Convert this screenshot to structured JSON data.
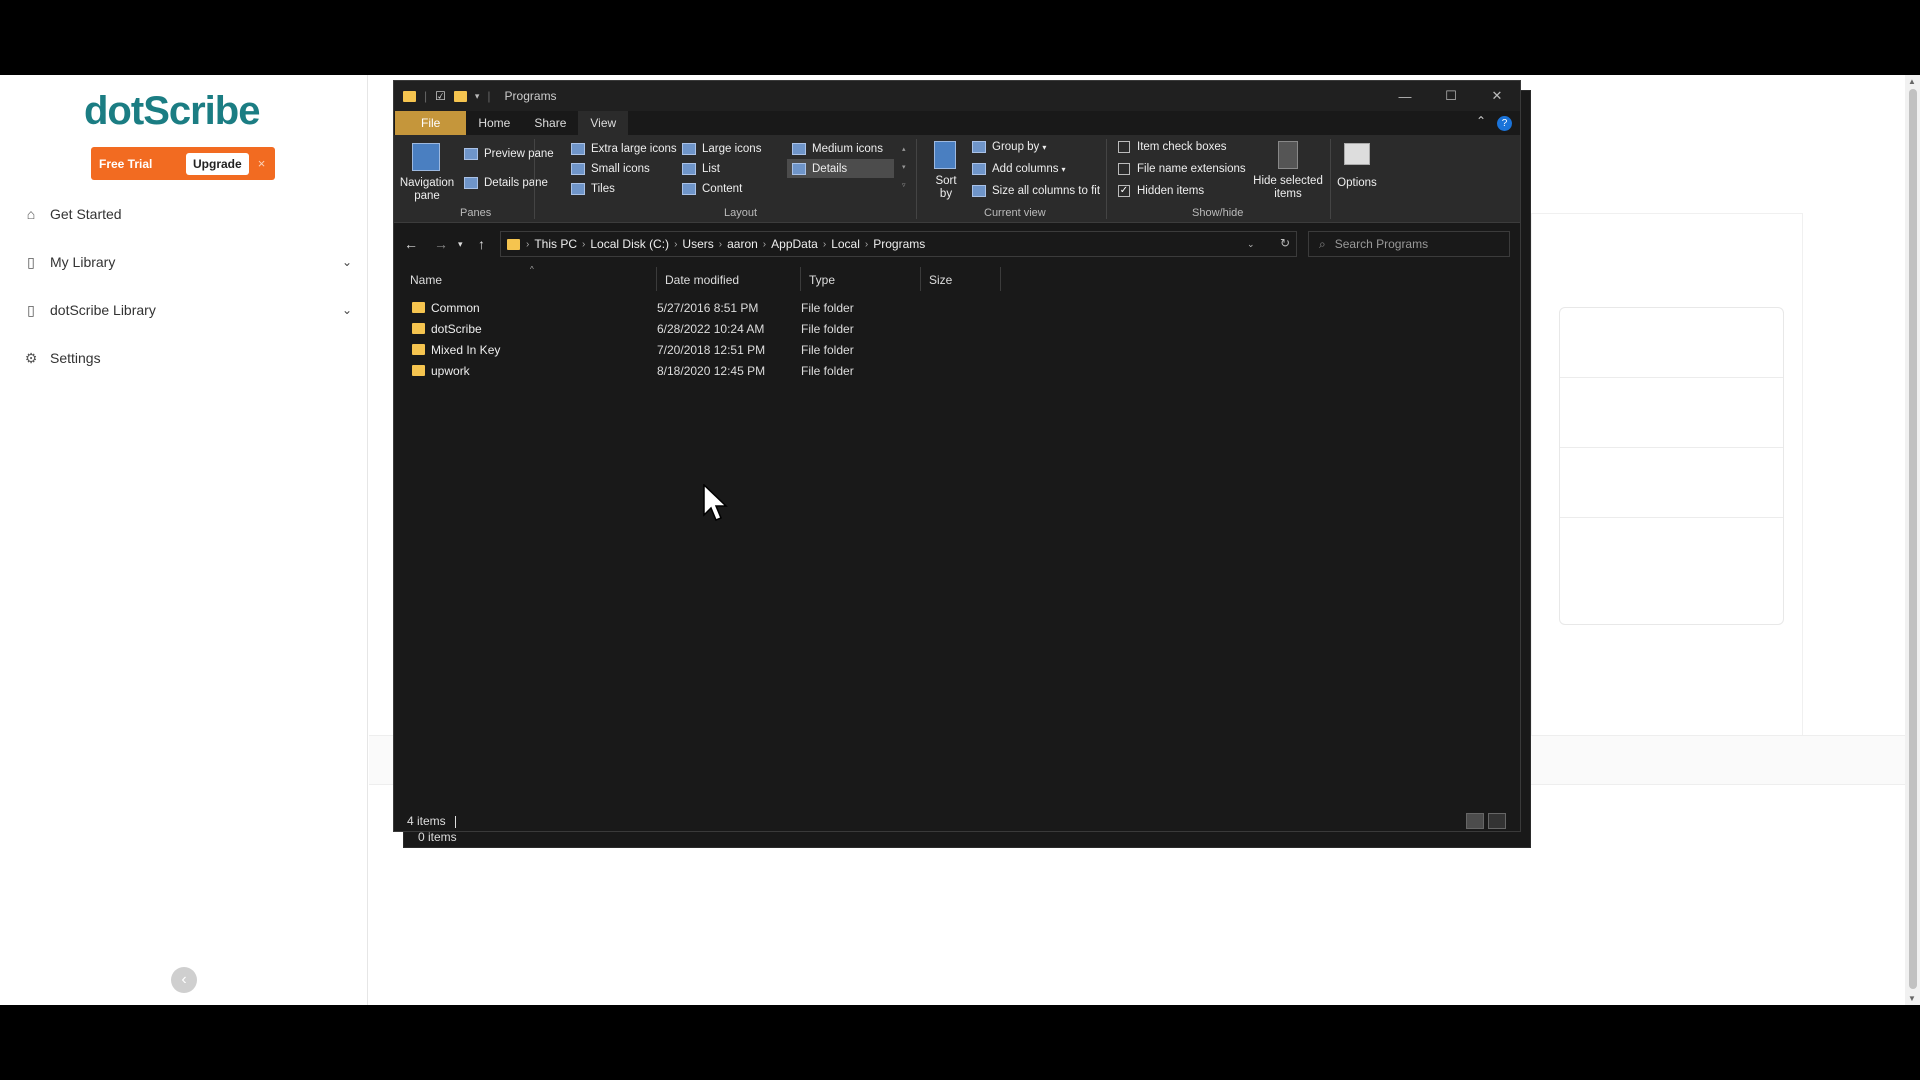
{
  "app": {
    "brand": "dotScribe",
    "trial": {
      "label": "Free Trial",
      "upgrade": "Upgrade",
      "close": "×"
    },
    "nav": [
      {
        "label": "Get Started",
        "icon": "home-icon"
      },
      {
        "label": "My Library",
        "icon": "book-icon"
      },
      {
        "label": "dotScribe Library",
        "icon": "book-icon"
      },
      {
        "label": "Settings",
        "icon": "gear-icon"
      }
    ],
    "collapse": "‹"
  },
  "explorer": {
    "title": "Programs",
    "tabs": {
      "file": "File",
      "home": "Home",
      "share": "Share",
      "view": "View"
    },
    "ribbon": {
      "panes": {
        "navigation": "Navigation pane",
        "preview": "Preview pane",
        "details": "Details pane",
        "label": "Panes"
      },
      "layout": {
        "extra_large": "Extra large icons",
        "large": "Large icons",
        "medium": "Medium icons",
        "small": "Small icons",
        "list": "List",
        "details": "Details",
        "tiles": "Tiles",
        "content": "Content",
        "label": "Layout"
      },
      "current_view": {
        "sort": "Sort by",
        "group": "Group by",
        "add_columns": "Add columns",
        "size_all": "Size all columns to fit",
        "label": "Current view"
      },
      "show_hide": {
        "item_check_boxes": "Item check boxes",
        "file_name_extensions": "File name extensions",
        "hidden_items": "Hidden items",
        "hide_selected": "Hide selected items",
        "label": "Show/hide"
      },
      "options": "Options"
    },
    "breadcrumb": [
      "This PC",
      "Local Disk (C:)",
      "Users",
      "aaron",
      "AppData",
      "Local",
      "Programs"
    ],
    "search_placeholder": "Search Programs",
    "columns": {
      "name": "Name",
      "date": "Date modified",
      "type": "Type",
      "size": "Size"
    },
    "files": [
      {
        "name": "Common",
        "date": "5/27/2016 8:51 PM",
        "type": "File folder"
      },
      {
        "name": "dotScribe",
        "date": "6/28/2022 10:24 AM",
        "type": "File folder"
      },
      {
        "name": "Mixed In Key",
        "date": "7/20/2018 12:51 PM",
        "type": "File folder"
      },
      {
        "name": "upwork",
        "date": "8/18/2020 12:45 PM",
        "type": "File folder"
      }
    ],
    "status": "4 items",
    "status_behind": "0 items"
  }
}
